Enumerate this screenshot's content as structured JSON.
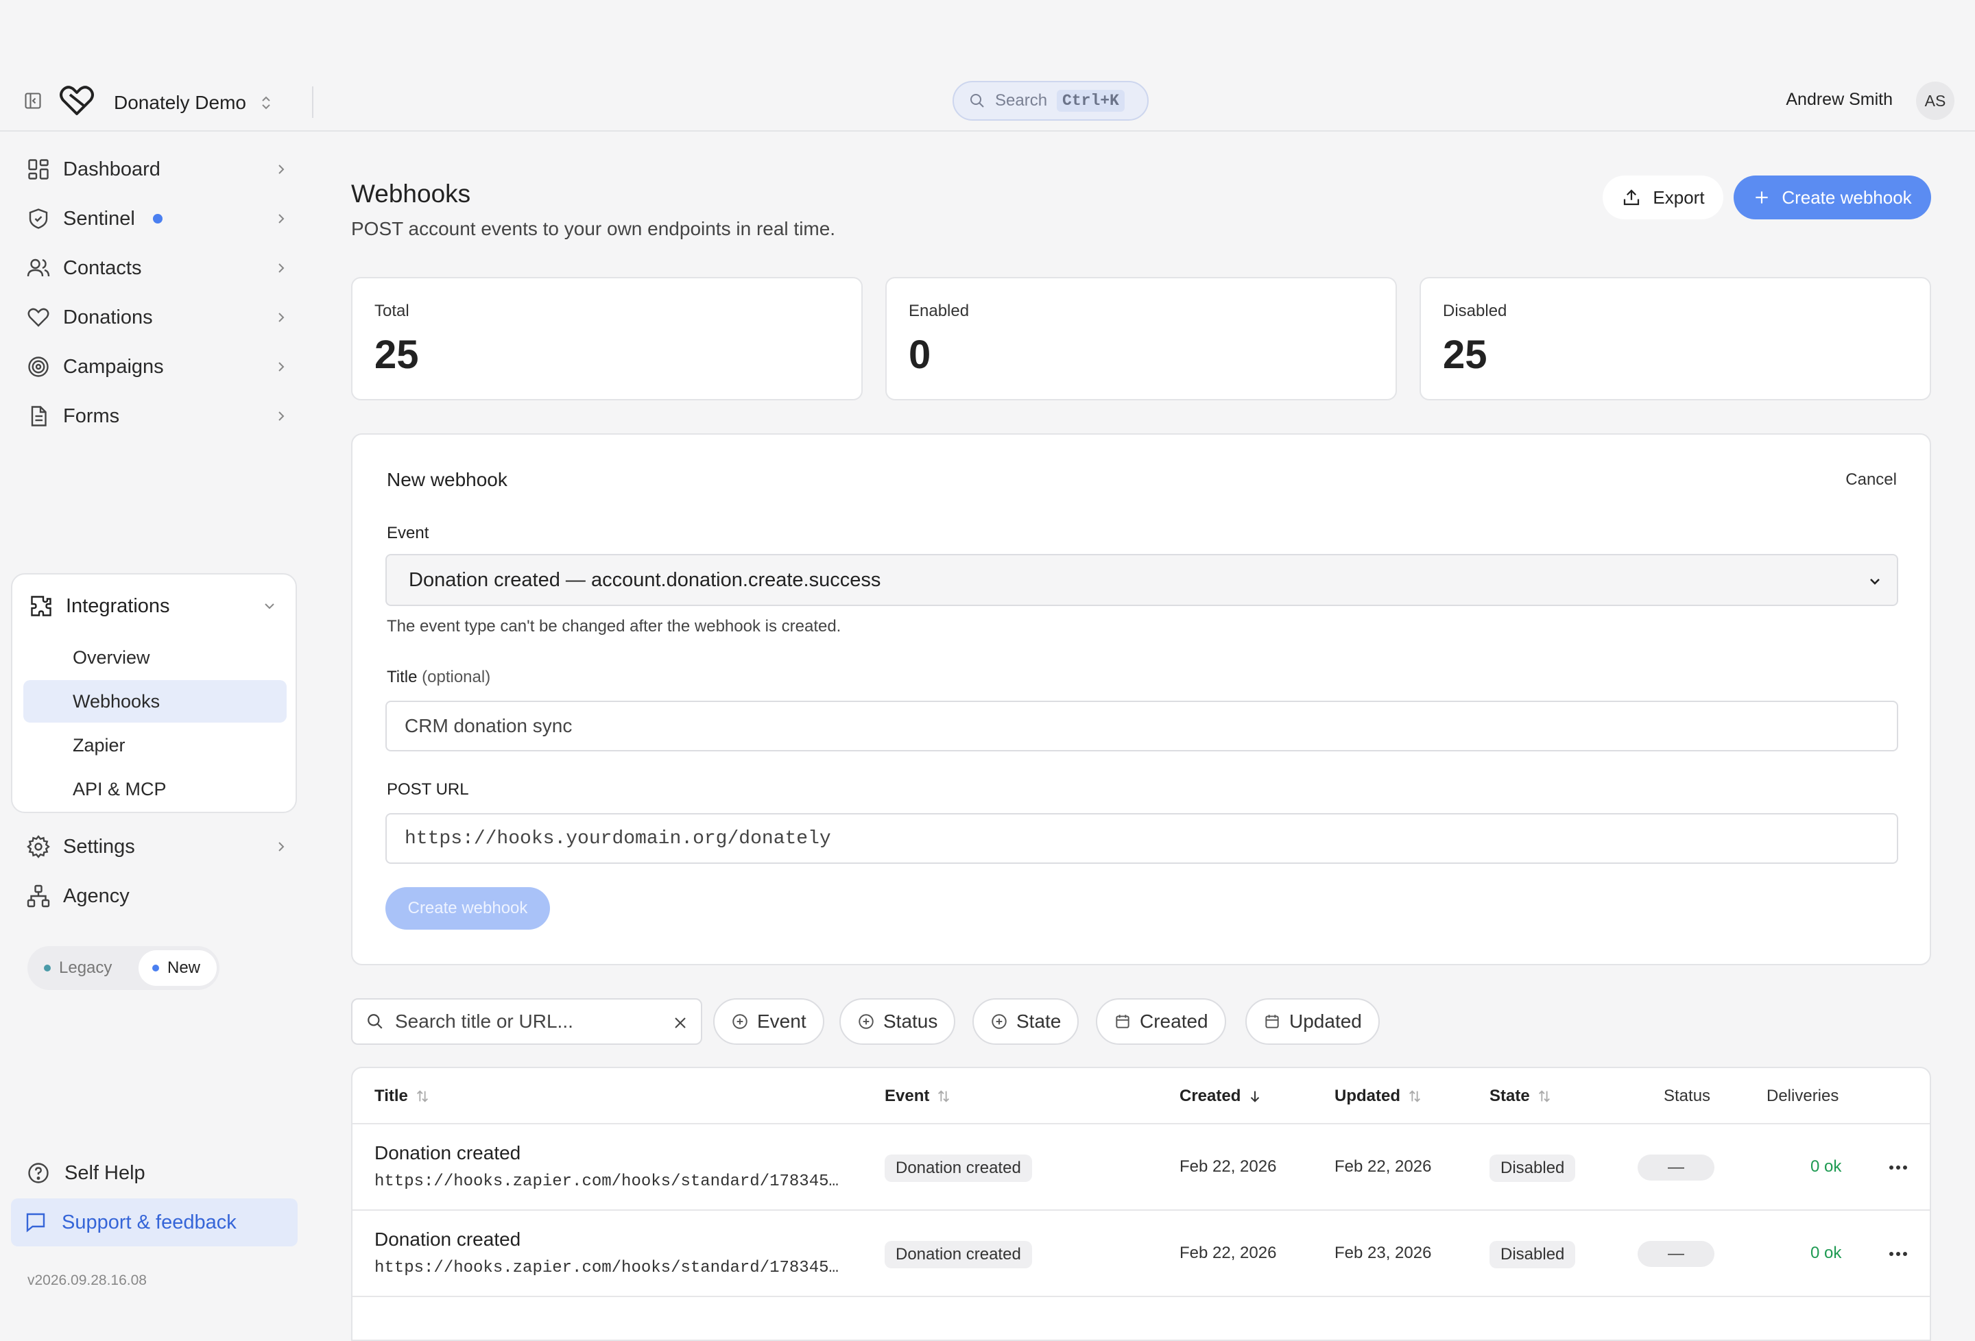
{
  "topbar": {
    "account_name": "Donately Demo",
    "search_label": "Search",
    "search_shortcut": "Ctrl+K",
    "user_name": "Andrew Smith",
    "user_initials": "AS"
  },
  "sidebar": {
    "items": [
      {
        "label": "Dashboard",
        "icon": "dashboard-icon"
      },
      {
        "label": "Sentinel",
        "icon": "shield-icon"
      },
      {
        "label": "Contacts",
        "icon": "users-icon"
      },
      {
        "label": "Donations",
        "icon": "heart-icon"
      },
      {
        "label": "Campaigns",
        "icon": "target-icon"
      },
      {
        "label": "Forms",
        "icon": "document-icon"
      }
    ],
    "integrations": {
      "label": "Integrations",
      "sub_items": [
        "Overview",
        "Webhooks",
        "Zapier",
        "API & MCP"
      ]
    },
    "settings_label": "Settings",
    "agency_label": "Agency",
    "toggle": {
      "legacy": "Legacy",
      "new": "New"
    },
    "self_help": "Self Help",
    "support": "Support & feedback",
    "version": "v2026.09.28.16.08"
  },
  "page": {
    "title": "Webhooks",
    "subtitle": "POST account events to your own endpoints in real time.",
    "export_label": "Export",
    "create_label": "Create webhook"
  },
  "stats": [
    {
      "label": "Total",
      "value": "25"
    },
    {
      "label": "Enabled",
      "value": "0"
    },
    {
      "label": "Disabled",
      "value": "25"
    }
  ],
  "form": {
    "title": "New webhook",
    "cancel": "Cancel",
    "event_label": "Event",
    "event_value": "Donation created — account.donation.create.success",
    "event_help": "The event type can't be changed after the webhook is created.",
    "title_label": "Title",
    "title_optional": "(optional)",
    "title_value": "CRM donation sync",
    "url_label": "POST URL",
    "url_value": "https://hooks.yourdomain.org/donately",
    "submit": "Create webhook"
  },
  "filters": {
    "search_placeholder": "Search title or URL...",
    "chips": [
      "Event",
      "Status",
      "State",
      "Created",
      "Updated"
    ]
  },
  "table": {
    "columns": [
      "Title",
      "Event",
      "Created",
      "Updated",
      "State",
      "Status",
      "Deliveries"
    ],
    "rows": [
      {
        "title": "Donation created",
        "url": "https://hooks.zapier.com/hooks/standard/178345…",
        "event": "Donation created",
        "created": "Feb 22, 2026",
        "updated": "Feb 22, 2026",
        "state": "Disabled",
        "status": "—",
        "deliveries": "0 ok"
      },
      {
        "title": "Donation created",
        "url": "https://hooks.zapier.com/hooks/standard/178345…",
        "event": "Donation created",
        "created": "Feb 22, 2026",
        "updated": "Feb 23, 2026",
        "state": "Disabled",
        "status": "—",
        "deliveries": "0 ok"
      }
    ]
  },
  "colors": {
    "accent": "#5b8cf2",
    "accent_disabled": "#a9c2f8",
    "success": "#1e9a52",
    "active_bg": "#e6ecfa"
  }
}
